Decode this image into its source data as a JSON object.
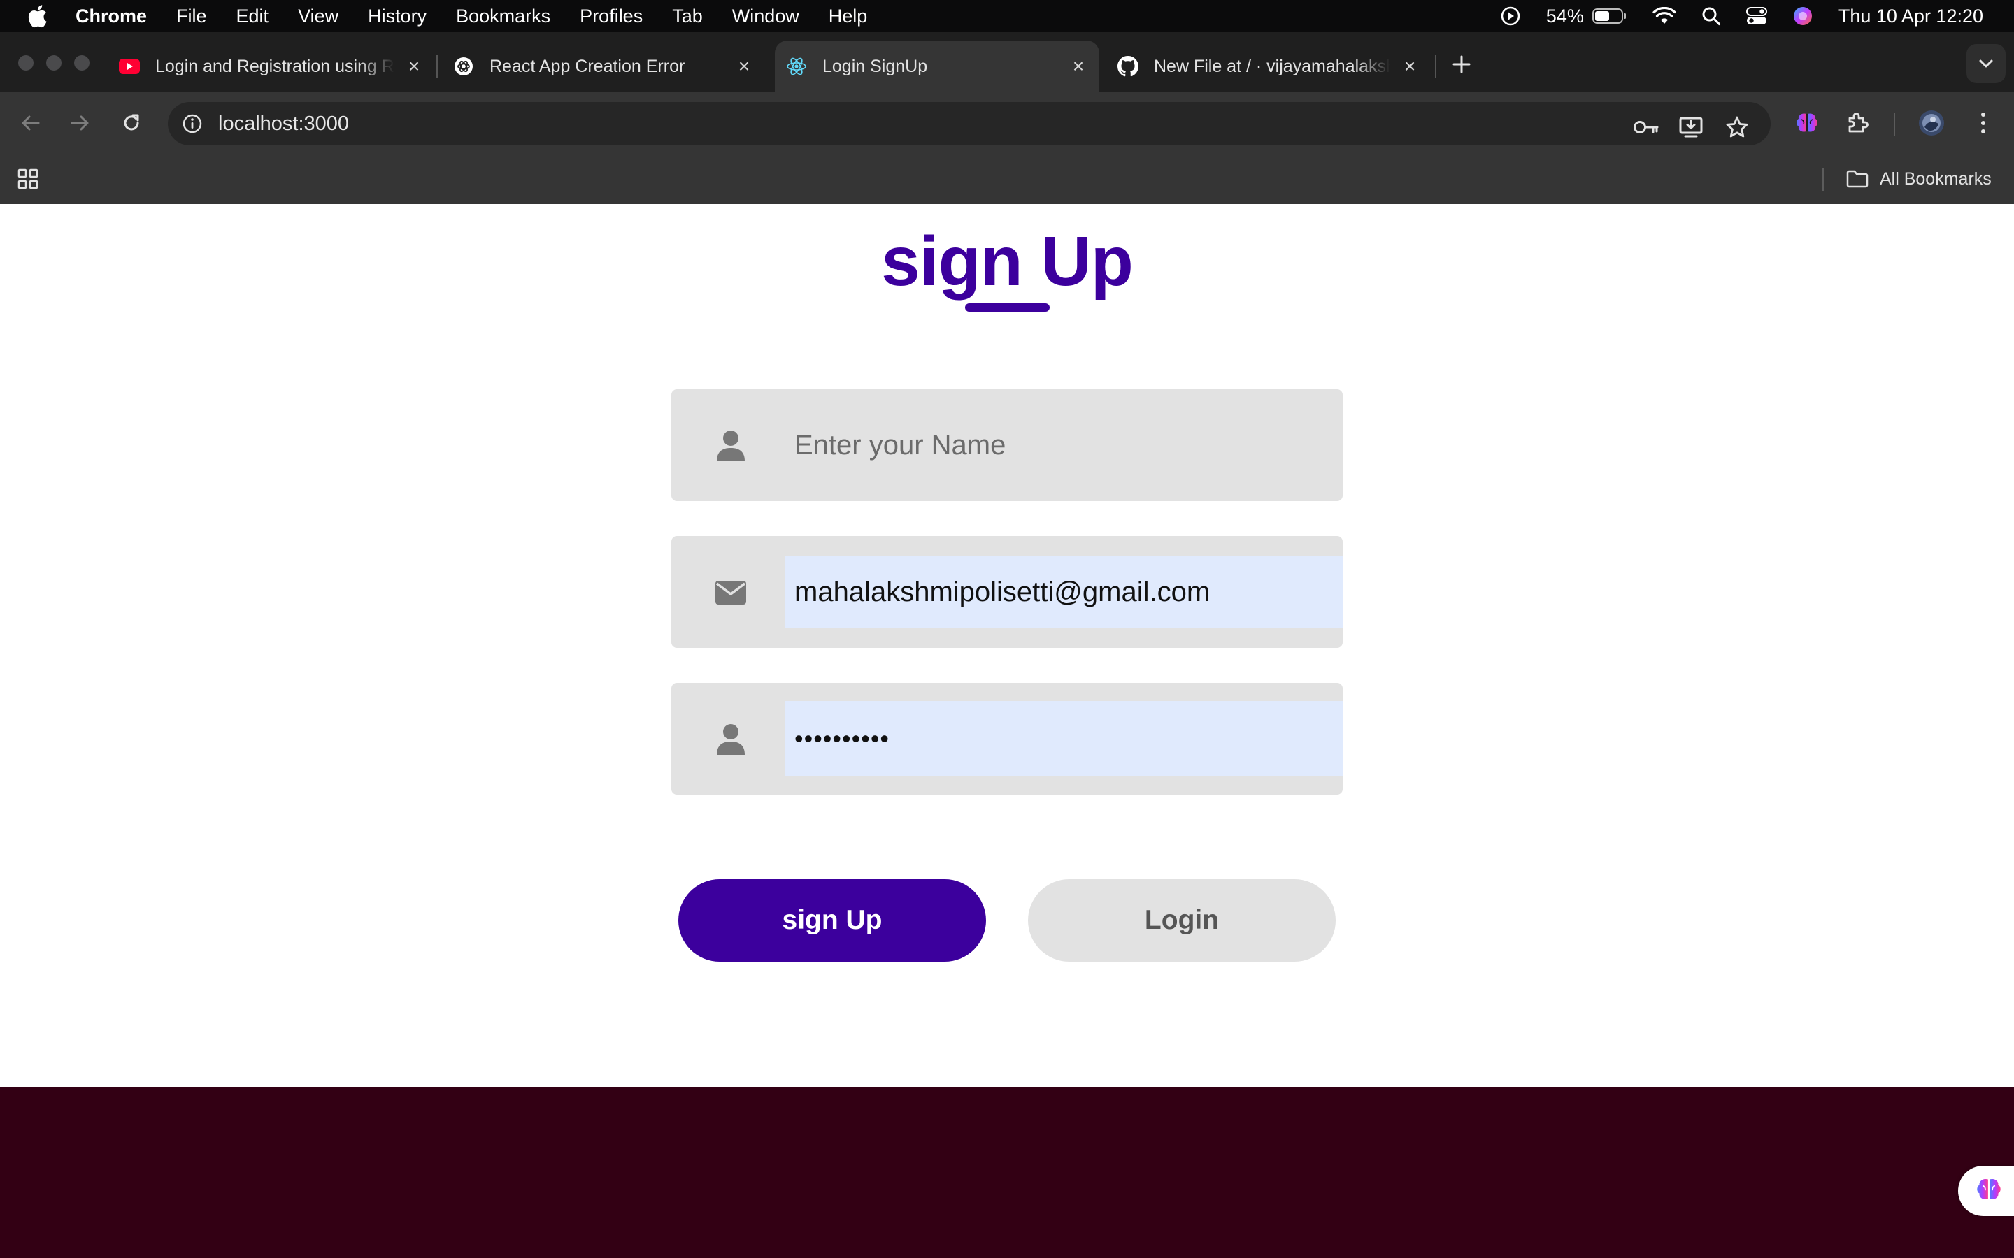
{
  "menubar": {
    "app_name": "Chrome",
    "menus": [
      "File",
      "Edit",
      "View",
      "History",
      "Bookmarks",
      "Profiles",
      "Tab",
      "Window",
      "Help"
    ],
    "battery_percent": "54%",
    "clock": "Thu 10 Apr  12:20"
  },
  "tabs": [
    {
      "title": "Login and Registration using R",
      "favicon": "youtube-icon",
      "active": false
    },
    {
      "title": "React App Creation Error",
      "favicon": "openai-icon",
      "active": false
    },
    {
      "title": "Login SignUp",
      "favicon": "react-icon",
      "active": true
    },
    {
      "title": "New File at / · vijayamahalakshm",
      "favicon": "github-icon",
      "active": false
    }
  ],
  "toolbar": {
    "url": "localhost:3000"
  },
  "bookmarks_bar": {
    "all_bookmarks_label": "All Bookmarks"
  },
  "page": {
    "title": "sign Up",
    "name_field": {
      "placeholder": "Enter your Name",
      "value": ""
    },
    "email_field": {
      "value": "mahalakshmipolisetti@gmail.com"
    },
    "password_field": {
      "value": "••••••••••"
    },
    "signup_button": "sign Up",
    "login_button": "Login"
  },
  "colors": {
    "accent": "#3c009d",
    "footer": "#330014",
    "field_bg": "#e2e2e2",
    "autofill_bg": "#e0eafd"
  }
}
